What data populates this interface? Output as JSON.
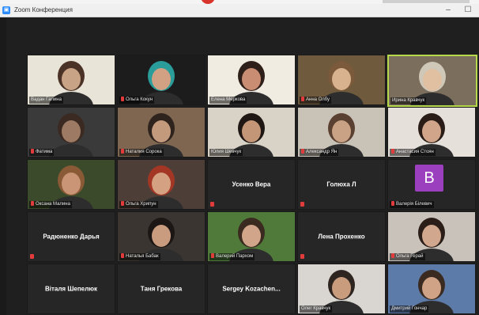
{
  "window": {
    "title": "Zoom Конференция",
    "minimize": "–",
    "maximize": "☐"
  },
  "participants": [
    {
      "name": "Вадан Галина",
      "video": true,
      "mute": false,
      "bg": "#e9e4d8",
      "face": "#c9a386",
      "hair": "#4a3326"
    },
    {
      "name": "Ольга Кокун",
      "video": true,
      "mute": true,
      "bg": "#1c1c1c",
      "face": "#d2a082",
      "hair": "#2a9d9b"
    },
    {
      "name": "Елена Меркова",
      "video": true,
      "mute": false,
      "bg": "#f1ece2",
      "face": "#c88d73",
      "hair": "#2f1f1a"
    },
    {
      "name": "Анна Олбу",
      "video": true,
      "mute": true,
      "bg": "#6f5a3d",
      "face": "#d8b18e",
      "hair": "#7a5a3a"
    },
    {
      "name": "Ирина Кравчук",
      "video": true,
      "mute": false,
      "bg": "#7b6e5c",
      "face": "#e0c0a0",
      "hair": "#cfc7b8",
      "active": true
    },
    {
      "name": "Фатима",
      "video": true,
      "mute": true,
      "bg": "#3a3a3a",
      "face": "#9d7a63",
      "hair": "#3a2a22"
    },
    {
      "name": "Наталия Сорока",
      "video": true,
      "mute": true,
      "bg": "#7f6650",
      "face": "#c49a7d",
      "hair": "#2f231d"
    },
    {
      "name": "Юлия Шевчук",
      "video": true,
      "mute": false,
      "bg": "#d9d2c6",
      "face": "#c39677",
      "hair": "#1f1714"
    },
    {
      "name": "Александр Ян",
      "video": true,
      "mute": true,
      "bg": "#c9c2b6",
      "face": "#c9a185",
      "hair": "#5a4030"
    },
    {
      "name": "Анастасия Стоян",
      "video": true,
      "mute": true,
      "bg": "#e6e0da",
      "face": "#d0a589",
      "hair": "#2a1d17"
    },
    {
      "name": "Оксана Малина",
      "video": true,
      "mute": true,
      "bg": "#3b4a2a",
      "face": "#c99576",
      "hair": "#8a5a36"
    },
    {
      "name": "Ольга Хрипун",
      "video": true,
      "mute": true,
      "bg": "#4d3f37",
      "face": "#d4a283",
      "hair": "#a33624"
    },
    {
      "name": "Усенко Вера",
      "video": false,
      "mute": true
    },
    {
      "name": "Голюха Л",
      "video": false,
      "mute": true
    },
    {
      "name": "Валерія Білевич",
      "video": false,
      "mute": true,
      "avatar": "B"
    },
    {
      "name": "Радюненко Дарья",
      "video": false,
      "mute": true
    },
    {
      "name": "Наталья Бабак",
      "video": true,
      "mute": true,
      "bg": "#3a3530",
      "face": "#c99b7f",
      "hair": "#1c1714"
    },
    {
      "name": "Валерий Пархом",
      "video": true,
      "mute": true,
      "bg": "#4f7a3a",
      "face": "#d0a58a",
      "hair": "#3a2a1f"
    },
    {
      "name": "Лена Прохенко",
      "video": false,
      "mute": true
    },
    {
      "name": "Ольга Герай",
      "video": true,
      "mute": true,
      "bg": "#c9c2bb",
      "face": "#d1a88e",
      "hair": "#2b1e18"
    },
    {
      "name": "Віталя Шепелюк",
      "video": false,
      "mute": false
    },
    {
      "name": "Таня Грекова",
      "video": false,
      "mute": false
    },
    {
      "name": "Sergey  Kozachen...",
      "video": false,
      "mute": false
    },
    {
      "name": "Олег Кравчук",
      "video": true,
      "mute": false,
      "bg": "#d9d6d1",
      "face": "#c99c7e",
      "hair": "#2f2520"
    },
    {
      "name": "Дмитрий Гончар",
      "video": true,
      "mute": false,
      "bg": "#5d7ba8",
      "face": "#d0a386",
      "hair": "#3a2a20"
    }
  ]
}
